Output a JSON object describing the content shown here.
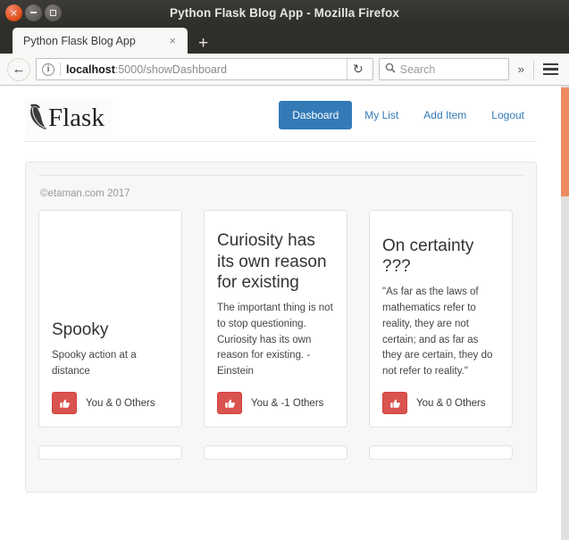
{
  "window": {
    "title": "Python Flask Blog App - Mozilla Firefox",
    "close_label": "×",
    "minimize_label": "−",
    "maximize_label": "□"
  },
  "tab": {
    "title": "Python Flask Blog App",
    "close_label": "×",
    "new_tab_label": "+"
  },
  "browser_toolbar": {
    "back_label": "←",
    "info_label": "i",
    "url_host": "localhost",
    "url_path": ":5000/showDashboard",
    "reload_label": "↻",
    "search_placeholder": "Search",
    "search_value": "",
    "search_glyph": "⚲",
    "overflow_label": "»"
  },
  "site": {
    "brand_text": "Flask",
    "nav": [
      {
        "label": "Dasboard",
        "active": true
      },
      {
        "label": "My List",
        "active": false
      },
      {
        "label": "Add Item",
        "active": false
      },
      {
        "label": "Logout",
        "active": false
      }
    ],
    "copyright": "©etaman.com 2017"
  },
  "cards": [
    {
      "title": "Spooky",
      "text": "Spooky action at a distance",
      "like_label": "You & 0 Others"
    },
    {
      "title": "Curiosity has its own reason for existing",
      "text": "The important thing is not to stop questioning. Curiosity has its own reason for existing. - Einstein",
      "like_label": "You & -1 Others"
    },
    {
      "title": "On certainty ???",
      "text": "\"As far as the laws of mathematics refer to reality, they are not certain; and as far as they are certain, they do not refer to reality.\"",
      "like_label": "You & 0 Others"
    }
  ],
  "colors": {
    "primary": "#337ab7",
    "danger": "#d9534f",
    "scrollbar": "#ee8a5f",
    "panel_bg": "#f7f7f7"
  }
}
